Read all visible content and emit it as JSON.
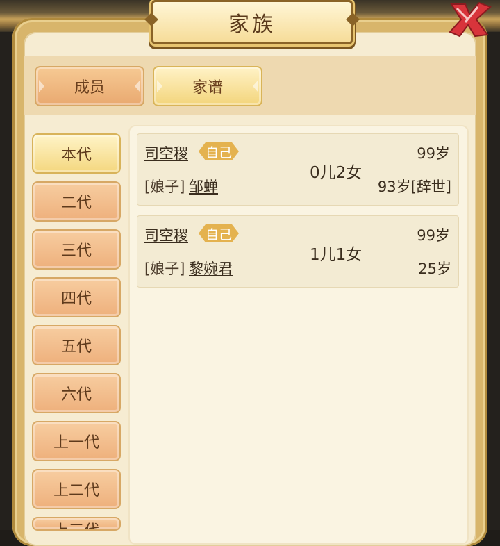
{
  "window": {
    "title": "家族"
  },
  "top_tabs": [
    {
      "label": "成员",
      "active": false
    },
    {
      "label": "家谱",
      "active": true
    }
  ],
  "generations": [
    {
      "label": "本代",
      "active": true
    },
    {
      "label": "二代",
      "active": false
    },
    {
      "label": "三代",
      "active": false
    },
    {
      "label": "四代",
      "active": false
    },
    {
      "label": "五代",
      "active": false
    },
    {
      "label": "六代",
      "active": false
    },
    {
      "label": "上一代",
      "active": false
    },
    {
      "label": "上二代",
      "active": false
    },
    {
      "label": "上三代",
      "active": false
    }
  ],
  "records": [
    {
      "name": "司空稷",
      "badge": "自己",
      "spouse_label": "[娘子]",
      "spouse_name": "邹蝉",
      "children": "0儿2女",
      "age": "99岁",
      "spouse_age": "93岁[辞世]"
    },
    {
      "name": "司空稷",
      "badge": "自己",
      "spouse_label": "[娘子]",
      "spouse_name": "黎婉君",
      "children": "1儿1女",
      "age": "99岁",
      "spouse_age": "25岁"
    }
  ],
  "colors": {
    "frame_gold": "#d8b56b",
    "panel_bg": "#f6ecd2",
    "active_tab": "#f4d77f",
    "inactive_tab": "#eeb07c",
    "badge": "#e4b24f",
    "close_red": "#d8343b"
  },
  "icons": {
    "close": "close-icon"
  }
}
